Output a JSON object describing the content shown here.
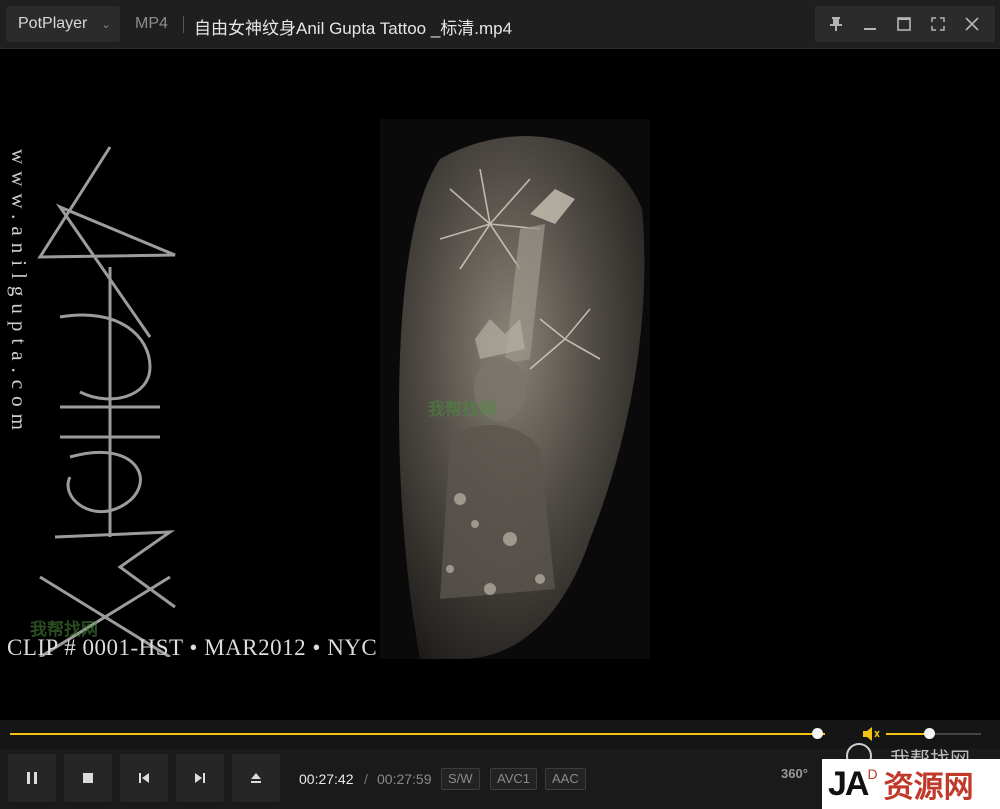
{
  "app": {
    "name": "PotPlayer",
    "format": "MP4",
    "filename": "自由女神纹身Anil Gupta Tattoo _标清.mp4"
  },
  "video": {
    "watermark_url": "www.anilgupta.com",
    "clip_caption": "CLIP # 0001-HST • MAR2012 • NYC",
    "cn_watermark": "我帮找网"
  },
  "playback": {
    "current_time": "00:27:42",
    "separator": "/",
    "total_time": "00:27:59",
    "progress_fraction": 0.99,
    "volume_fraction": 0.45,
    "badges": [
      "S/W",
      "AVC1",
      "AAC"
    ],
    "vr_label": "360°"
  },
  "overlay": {
    "cn_text": "我帮找网",
    "logo_latin": "JA",
    "logo_sup": "D",
    "logo_cn": "资源网"
  },
  "colors": {
    "accent": "#f2c40f",
    "titlebar": "#1f1f1f",
    "controls": "#1a1a1a"
  },
  "icons": {
    "logo_dropdown": "chevron-down-icon",
    "pin": "pin-icon",
    "minimize": "minimize-icon",
    "maximize": "maximize-icon",
    "fullscreen": "fullscreen-icon",
    "close": "close-icon",
    "play_pause": "pause-icon",
    "stop": "stop-icon",
    "previous": "previous-icon",
    "next": "next-icon",
    "eject": "eject-icon",
    "volume": "speaker-icon"
  }
}
